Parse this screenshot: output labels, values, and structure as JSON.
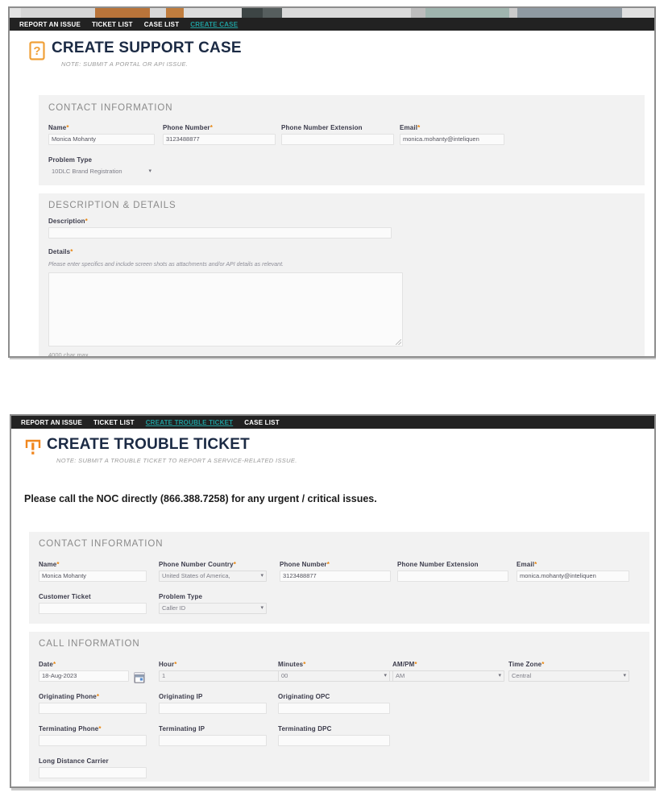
{
  "panel_support_case": {
    "nav": {
      "items": [
        {
          "label": "REPORT AN ISSUE",
          "active": false
        },
        {
          "label": "TICKET LIST",
          "active": false
        },
        {
          "label": "CASE LIST",
          "active": false
        },
        {
          "label": "CREATE CASE",
          "active": true
        }
      ]
    },
    "header": {
      "icon": "question-mark-box-icon",
      "title": "CREATE SUPPORT CASE",
      "note": "NOTE: SUBMIT A PORTAL OR API ISSUE."
    },
    "contact_section": {
      "title": "CONTACT INFORMATION",
      "fields": {
        "name": {
          "label": "Name",
          "required": true,
          "value": "Monica Mohanty"
        },
        "phone_number": {
          "label": "Phone Number",
          "required": true,
          "value": "3123488877"
        },
        "phone_extension": {
          "label": "Phone Number Extension",
          "required": false,
          "value": ""
        },
        "email": {
          "label": "Email",
          "required": true,
          "value": "monica.mohanty@inteliquen"
        },
        "problem_type": {
          "label": "Problem Type",
          "required": false,
          "value": "10DLC Brand Registration"
        }
      }
    },
    "description_section": {
      "title": "DESCRIPTION & DETAILS",
      "fields": {
        "description": {
          "label": "Description",
          "required": true,
          "value": ""
        },
        "details": {
          "label": "Details",
          "required": true,
          "hint": "Please enter specifics and include screen shots as attachments and/or API details as relevant.",
          "value": "",
          "char_max": "4000 char max"
        }
      }
    }
  },
  "panel_trouble_ticket": {
    "nav": {
      "items": [
        {
          "label": "REPORT AN ISSUE",
          "active": false
        },
        {
          "label": "TICKET LIST",
          "active": false
        },
        {
          "label": "CREATE TROUBLE TICKET",
          "active": true
        },
        {
          "label": "CASE LIST",
          "active": false
        }
      ]
    },
    "header": {
      "icon": "exclamation-mark-box-icon",
      "title": "CREATE TROUBLE TICKET",
      "note": "NOTE: SUBMIT A TROUBLE TICKET TO REPORT A SERVICE-RELATED ISSUE."
    },
    "alert": "Please call the NOC directly (866.388.7258) for any urgent / critical issues.",
    "contact_section": {
      "title": "CONTACT INFORMATION",
      "fields": {
        "name": {
          "label": "Name",
          "required": true,
          "value": "Monica Mohanty"
        },
        "phone_country": {
          "label": "Phone Number Country",
          "required": true,
          "value": "United States of America,"
        },
        "phone_number": {
          "label": "Phone Number",
          "required": true,
          "value": "3123488877"
        },
        "phone_extension": {
          "label": "Phone Number Extension",
          "required": false,
          "value": ""
        },
        "email": {
          "label": "Email",
          "required": true,
          "value": "monica.mohanty@inteliquen"
        },
        "customer_ticket": {
          "label": "Customer Ticket",
          "required": false,
          "value": ""
        },
        "problem_type": {
          "label": "Problem Type",
          "required": false,
          "value": "Caller ID"
        }
      }
    },
    "call_section": {
      "title": "CALL INFORMATION",
      "fields": {
        "date": {
          "label": "Date",
          "required": true,
          "value": "18-Aug-2023",
          "icon": "calendar-icon"
        },
        "hour": {
          "label": "Hour",
          "required": true,
          "value": "1"
        },
        "minutes": {
          "label": "Minutes",
          "required": true,
          "value": "00"
        },
        "am_pm": {
          "label": "AM/PM",
          "required": true,
          "value": "AM"
        },
        "time_zone": {
          "label": "Time Zone",
          "required": true,
          "value": "Central"
        },
        "originating_phone": {
          "label": "Originating Phone",
          "required": true,
          "value": ""
        },
        "originating_ip": {
          "label": "Originating IP",
          "required": false,
          "value": ""
        },
        "originating_opc": {
          "label": "Originating OPC",
          "required": false,
          "value": ""
        },
        "terminating_phone": {
          "label": "Terminating Phone",
          "required": true,
          "value": ""
        },
        "terminating_ip": {
          "label": "Terminating IP",
          "required": false,
          "value": ""
        },
        "terminating_dpc": {
          "label": "Terminating DPC",
          "required": false,
          "value": ""
        },
        "long_distance_carrier": {
          "label": "Long Distance Carrier",
          "required": false,
          "value": ""
        }
      }
    }
  },
  "colors": {
    "nav_bg": "#222222",
    "nav_active": "#1f9e9e",
    "accent_orange": "#e8840c",
    "title_navy": "#1b2a44",
    "section_bg": "#f2f2f2",
    "label_gray": "#8a8a8a"
  }
}
